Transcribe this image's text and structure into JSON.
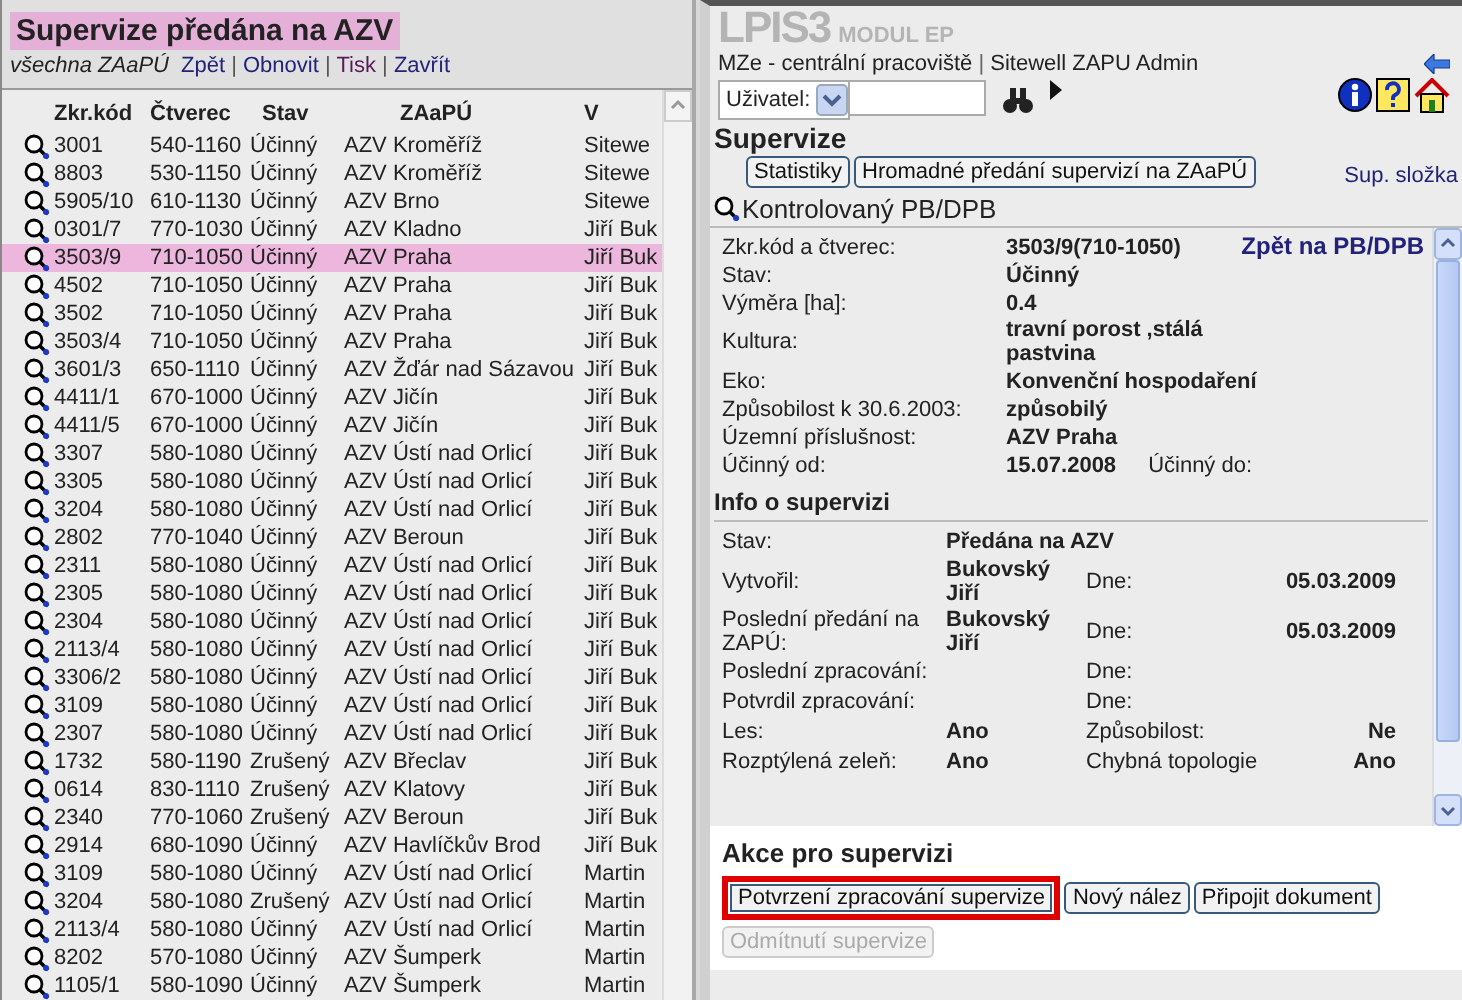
{
  "list_panel": {
    "title": "Supervize předána na AZV",
    "link_separator": "|",
    "links": [
      {
        "label": "všechna ZAaPÚ",
        "kind": "filter"
      },
      {
        "label": "Zpět",
        "kind": "link"
      },
      {
        "label": "Obnovit",
        "kind": "link"
      },
      {
        "label": "Tisk",
        "kind": "visited"
      },
      {
        "label": "Zavřít",
        "kind": "link"
      }
    ],
    "columns": [
      "Zkr.kód",
      "Čtverec",
      "Stav",
      "ZAaPÚ",
      "V"
    ],
    "rows": [
      {
        "cells": [
          "3001",
          "540-1160",
          "Účinný",
          "AZV Kroměříž",
          "Sitewe"
        ],
        "selected": false
      },
      {
        "cells": [
          "8803",
          "530-1150",
          "Účinný",
          "AZV Kroměříž",
          "Sitewe"
        ],
        "selected": false
      },
      {
        "cells": [
          "5905/10",
          "610-1130",
          "Účinný",
          "AZV Brno",
          "Sitewe"
        ],
        "selected": false
      },
      {
        "cells": [
          "0301/7",
          "770-1030",
          "Účinný",
          "AZV Kladno",
          "Jiří Buk"
        ],
        "selected": false
      },
      {
        "cells": [
          "3503/9",
          "710-1050",
          "Účinný",
          "AZV Praha",
          "Jiří Buk"
        ],
        "selected": true
      },
      {
        "cells": [
          "4502",
          "710-1050",
          "Účinný",
          "AZV Praha",
          "Jiří Buk"
        ],
        "selected": false
      },
      {
        "cells": [
          "3502",
          "710-1050",
          "Účinný",
          "AZV Praha",
          "Jiří Buk"
        ],
        "selected": false
      },
      {
        "cells": [
          "3503/4",
          "710-1050",
          "Účinný",
          "AZV Praha",
          "Jiří Buk"
        ],
        "selected": false
      },
      {
        "cells": [
          "3601/3",
          "650-1110",
          "Účinný",
          "AZV Žďár nad Sázavou",
          "Jiří Buk"
        ],
        "selected": false
      },
      {
        "cells": [
          "4411/1",
          "670-1000",
          "Účinný",
          "AZV Jičín",
          "Jiří Buk"
        ],
        "selected": false
      },
      {
        "cells": [
          "4411/5",
          "670-1000",
          "Účinný",
          "AZV Jičín",
          "Jiří Buk"
        ],
        "selected": false
      },
      {
        "cells": [
          "3307",
          "580-1080",
          "Účinný",
          "AZV Ústí nad Orlicí",
          "Jiří Buk"
        ],
        "selected": false
      },
      {
        "cells": [
          "3305",
          "580-1080",
          "Účinný",
          "AZV Ústí nad Orlicí",
          "Jiří Buk"
        ],
        "selected": false
      },
      {
        "cells": [
          "3204",
          "580-1080",
          "Účinný",
          "AZV Ústí nad Orlicí",
          "Jiří Buk"
        ],
        "selected": false
      },
      {
        "cells": [
          "2802",
          "770-1040",
          "Účinný",
          "AZV Beroun",
          "Jiří Buk"
        ],
        "selected": false
      },
      {
        "cells": [
          "2311",
          "580-1080",
          "Účinný",
          "AZV Ústí nad Orlicí",
          "Jiří Buk"
        ],
        "selected": false
      },
      {
        "cells": [
          "2305",
          "580-1080",
          "Účinný",
          "AZV Ústí nad Orlicí",
          "Jiří Buk"
        ],
        "selected": false
      },
      {
        "cells": [
          "2304",
          "580-1080",
          "Účinný",
          "AZV Ústí nad Orlicí",
          "Jiří Buk"
        ],
        "selected": false
      },
      {
        "cells": [
          "2113/4",
          "580-1080",
          "Účinný",
          "AZV Ústí nad Orlicí",
          "Jiří Buk"
        ],
        "selected": false
      },
      {
        "cells": [
          "3306/2",
          "580-1080",
          "Účinný",
          "AZV Ústí nad Orlicí",
          "Jiří Buk"
        ],
        "selected": false
      },
      {
        "cells": [
          "3109",
          "580-1080",
          "Účinný",
          "AZV Ústí nad Orlicí",
          "Jiří Buk"
        ],
        "selected": false
      },
      {
        "cells": [
          "2307",
          "580-1080",
          "Účinný",
          "AZV Ústí nad Orlicí",
          "Jiří Buk"
        ],
        "selected": false
      },
      {
        "cells": [
          "1732",
          "580-1190",
          "Zrušený",
          "AZV Břeclav",
          "Jiří Buk"
        ],
        "selected": false
      },
      {
        "cells": [
          "0614",
          "830-1110",
          "Zrušený",
          "AZV Klatovy",
          "Jiří Buk"
        ],
        "selected": false
      },
      {
        "cells": [
          "2340",
          "770-1060",
          "Zrušený",
          "AZV Beroun",
          "Jiří Buk"
        ],
        "selected": false
      },
      {
        "cells": [
          "2914",
          "680-1090",
          "Účinný",
          "AZV Havlíčkův Brod",
          "Jiří Buk"
        ],
        "selected": false
      },
      {
        "cells": [
          "3109",
          "580-1080",
          "Účinný",
          "AZV Ústí nad Orlicí",
          "Martin"
        ],
        "selected": false
      },
      {
        "cells": [
          "3204",
          "580-1080",
          "Zrušený",
          "AZV Ústí nad Orlicí",
          "Martin"
        ],
        "selected": false
      },
      {
        "cells": [
          "2113/4",
          "580-1080",
          "Účinný",
          "AZV Ústí nad Orlicí",
          "Martin"
        ],
        "selected": false
      },
      {
        "cells": [
          "8202",
          "570-1080",
          "Účinný",
          "AZV Šumperk",
          "Martin"
        ],
        "selected": false
      },
      {
        "cells": [
          "1105/1",
          "580-1090",
          "Účinný",
          "AZV Šumperk",
          "Martin"
        ],
        "selected": false
      }
    ]
  },
  "detail_panel": {
    "app_name": "LPIS3",
    "module": "MODUL EP",
    "workplace": "MZe - centrální pracoviště",
    "separator": "|",
    "user": "Sitewell ZAPU Admin",
    "search": {
      "select_label": "Uživatel:"
    },
    "title": "Supervize",
    "buttons": [
      "Statistiky",
      "Hromadné předání supervizí na ZAaPÚ"
    ],
    "folder_link": "Sup. složka",
    "parcel": {
      "heading": "Kontrolovaný PB/DPB",
      "back_link": "Zpět na PB/DPB",
      "fields": [
        {
          "label": "Zkr.kód a čtverec:",
          "value": "3503/9(710-1050)"
        },
        {
          "label": "Stav:",
          "value": "Účinný"
        },
        {
          "label": "Výměra [ha]:",
          "value": "0.4"
        },
        {
          "label": "Kultura:",
          "value": "travní porost ,stálá pastvina"
        },
        {
          "label": "Eko:",
          "value": "Konvenční hospodaření"
        },
        {
          "label": "Způsobilost k 30.6.2003:",
          "value": "způsobilý"
        },
        {
          "label": "Územní příslušnost:",
          "value": "AZV Praha"
        },
        {
          "label": "Účinný od:",
          "value": "15.07.2008",
          "label_2": "Účinný do:"
        }
      ]
    },
    "info": {
      "heading": "Info o supervizi",
      "rows": [
        {
          "label": "Stav:",
          "value": "Předána na AZV"
        },
        {
          "label": "Vytvořil:",
          "value": "Bukovský Jiří",
          "label_2": "Dne:",
          "value_2": "05.03.2009"
        },
        {
          "label": "Poslední předání na ZAPÚ:",
          "value": "Bukovský Jiří",
          "label_2": "Dne:",
          "value_2": "05.03.2009"
        },
        {
          "label": "Poslední zpracování:",
          "label_2": "Dne:"
        },
        {
          "label": "Potvrdil zpracování:",
          "label_2": "Dne:"
        },
        {
          "label": "Les:",
          "value": "Ano",
          "label_2": "Způsobilost:",
          "value_2": "Ne"
        },
        {
          "label": "Rozptýlená zeleň:",
          "value": "Ano",
          "label_2": "Chybná topologie",
          "value_2": "Ano"
        }
      ]
    },
    "actions": {
      "heading": "Akce pro supervizi",
      "buttons": [
        {
          "label": "Potvrzení zpracování supervize",
          "highlighted": true,
          "disabled": false
        },
        {
          "label": "Nový nález",
          "highlighted": false,
          "disabled": false
        },
        {
          "label": "Připojit dokument",
          "highlighted": false,
          "disabled": false
        },
        {
          "label": "Odmítnutí supervize",
          "highlighted": false,
          "disabled": true
        }
      ]
    }
  }
}
